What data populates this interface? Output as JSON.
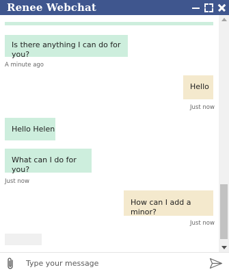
{
  "window": {
    "title": "Renee Webchat",
    "controls": [
      "minimize-icon",
      "maximize-icon",
      "close-icon"
    ]
  },
  "conversation": {
    "messages": [
      {
        "from": "agent",
        "text": "Is there anything I can do for you?"
      },
      {
        "from": "agent",
        "timestamp": "A minute ago"
      },
      {
        "from": "user",
        "text": "Hello"
      },
      {
        "from": "user",
        "timestamp": "Just now"
      },
      {
        "from": "agent",
        "text": "Hello Helen"
      },
      {
        "from": "agent",
        "text": "What can I do for you?"
      },
      {
        "from": "agent",
        "timestamp": "Just now"
      },
      {
        "from": "user",
        "text": "How can I add a minor?"
      },
      {
        "from": "user",
        "timestamp": "Just now"
      }
    ]
  },
  "composer": {
    "placeholder": "Type your message",
    "attach_icon": "paperclip-icon",
    "send_icon": "send-icon"
  },
  "colors": {
    "titlebar": "#3f568e",
    "agent_bubble": "#cdeedd",
    "user_bubble": "#f4e9cd"
  }
}
